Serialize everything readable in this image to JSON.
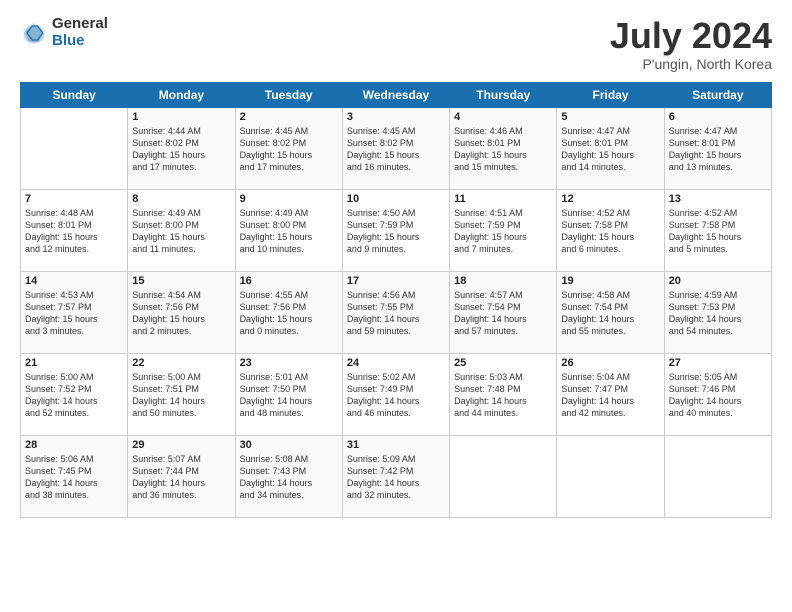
{
  "header": {
    "logo_general": "General",
    "logo_blue": "Blue",
    "title": "July 2024",
    "subtitle": "P'ungin, North Korea"
  },
  "calendar": {
    "days_of_week": [
      "Sunday",
      "Monday",
      "Tuesday",
      "Wednesday",
      "Thursday",
      "Friday",
      "Saturday"
    ],
    "weeks": [
      [
        {
          "day": "",
          "content": ""
        },
        {
          "day": "1",
          "content": "Sunrise: 4:44 AM\nSunset: 8:02 PM\nDaylight: 15 hours\nand 17 minutes."
        },
        {
          "day": "2",
          "content": "Sunrise: 4:45 AM\nSunset: 8:02 PM\nDaylight: 15 hours\nand 17 minutes."
        },
        {
          "day": "3",
          "content": "Sunrise: 4:45 AM\nSunset: 8:02 PM\nDaylight: 15 hours\nand 16 minutes."
        },
        {
          "day": "4",
          "content": "Sunrise: 4:46 AM\nSunset: 8:01 PM\nDaylight: 15 hours\nand 15 minutes."
        },
        {
          "day": "5",
          "content": "Sunrise: 4:47 AM\nSunset: 8:01 PM\nDaylight: 15 hours\nand 14 minutes."
        },
        {
          "day": "6",
          "content": "Sunrise: 4:47 AM\nSunset: 8:01 PM\nDaylight: 15 hours\nand 13 minutes."
        }
      ],
      [
        {
          "day": "7",
          "content": "Sunrise: 4:48 AM\nSunset: 8:01 PM\nDaylight: 15 hours\nand 12 minutes."
        },
        {
          "day": "8",
          "content": "Sunrise: 4:49 AM\nSunset: 8:00 PM\nDaylight: 15 hours\nand 11 minutes."
        },
        {
          "day": "9",
          "content": "Sunrise: 4:49 AM\nSunset: 8:00 PM\nDaylight: 15 hours\nand 10 minutes."
        },
        {
          "day": "10",
          "content": "Sunrise: 4:50 AM\nSunset: 7:59 PM\nDaylight: 15 hours\nand 9 minutes."
        },
        {
          "day": "11",
          "content": "Sunrise: 4:51 AM\nSunset: 7:59 PM\nDaylight: 15 hours\nand 7 minutes."
        },
        {
          "day": "12",
          "content": "Sunrise: 4:52 AM\nSunset: 7:58 PM\nDaylight: 15 hours\nand 6 minutes."
        },
        {
          "day": "13",
          "content": "Sunrise: 4:52 AM\nSunset: 7:58 PM\nDaylight: 15 hours\nand 5 minutes."
        }
      ],
      [
        {
          "day": "14",
          "content": "Sunrise: 4:53 AM\nSunset: 7:57 PM\nDaylight: 15 hours\nand 3 minutes."
        },
        {
          "day": "15",
          "content": "Sunrise: 4:54 AM\nSunset: 7:56 PM\nDaylight: 15 hours\nand 2 minutes."
        },
        {
          "day": "16",
          "content": "Sunrise: 4:55 AM\nSunset: 7:56 PM\nDaylight: 15 hours\nand 0 minutes."
        },
        {
          "day": "17",
          "content": "Sunrise: 4:56 AM\nSunset: 7:55 PM\nDaylight: 14 hours\nand 59 minutes."
        },
        {
          "day": "18",
          "content": "Sunrise: 4:57 AM\nSunset: 7:54 PM\nDaylight: 14 hours\nand 57 minutes."
        },
        {
          "day": "19",
          "content": "Sunrise: 4:58 AM\nSunset: 7:54 PM\nDaylight: 14 hours\nand 55 minutes."
        },
        {
          "day": "20",
          "content": "Sunrise: 4:59 AM\nSunset: 7:53 PM\nDaylight: 14 hours\nand 54 minutes."
        }
      ],
      [
        {
          "day": "21",
          "content": "Sunrise: 5:00 AM\nSunset: 7:52 PM\nDaylight: 14 hours\nand 52 minutes."
        },
        {
          "day": "22",
          "content": "Sunrise: 5:00 AM\nSunset: 7:51 PM\nDaylight: 14 hours\nand 50 minutes."
        },
        {
          "day": "23",
          "content": "Sunrise: 5:01 AM\nSunset: 7:50 PM\nDaylight: 14 hours\nand 48 minutes."
        },
        {
          "day": "24",
          "content": "Sunrise: 5:02 AM\nSunset: 7:49 PM\nDaylight: 14 hours\nand 46 minutes."
        },
        {
          "day": "25",
          "content": "Sunrise: 5:03 AM\nSunset: 7:48 PM\nDaylight: 14 hours\nand 44 minutes."
        },
        {
          "day": "26",
          "content": "Sunrise: 5:04 AM\nSunset: 7:47 PM\nDaylight: 14 hours\nand 42 minutes."
        },
        {
          "day": "27",
          "content": "Sunrise: 5:05 AM\nSunset: 7:46 PM\nDaylight: 14 hours\nand 40 minutes."
        }
      ],
      [
        {
          "day": "28",
          "content": "Sunrise: 5:06 AM\nSunset: 7:45 PM\nDaylight: 14 hours\nand 38 minutes."
        },
        {
          "day": "29",
          "content": "Sunrise: 5:07 AM\nSunset: 7:44 PM\nDaylight: 14 hours\nand 36 minutes."
        },
        {
          "day": "30",
          "content": "Sunrise: 5:08 AM\nSunset: 7:43 PM\nDaylight: 14 hours\nand 34 minutes."
        },
        {
          "day": "31",
          "content": "Sunrise: 5:09 AM\nSunset: 7:42 PM\nDaylight: 14 hours\nand 32 minutes."
        },
        {
          "day": "",
          "content": ""
        },
        {
          "day": "",
          "content": ""
        },
        {
          "day": "",
          "content": ""
        }
      ]
    ]
  }
}
